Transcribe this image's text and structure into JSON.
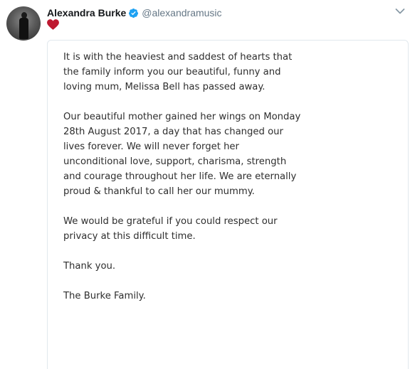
{
  "tweet": {
    "display_name": "Alexandra Burke",
    "handle": "@alexandramusic",
    "verified": true,
    "body_emoji": "heart-icon",
    "colors": {
      "name": "#14171a",
      "handle": "#657786",
      "verified": "#1da1f2",
      "heart": "#be1931",
      "card_border": "#e1e8ed"
    }
  },
  "statement": {
    "paragraphs": [
      "It is with the heaviest and saddest of hearts that\nthe family inform you our beautiful, funny and\nloving mum, Melissa Bell has passed away.",
      "Our beautiful mother gained her wings on Monday\n28th August 2017, a day that has changed our\nlives forever. We will never forget her\nunconditional love, support, charisma, strength\nand courage throughout her life. We are eternally\nproud & thankful to call her our mummy.",
      "We would be grateful if you could respect our\nprivacy at this difficult time.",
      "Thank you.",
      "The Burke Family."
    ]
  }
}
